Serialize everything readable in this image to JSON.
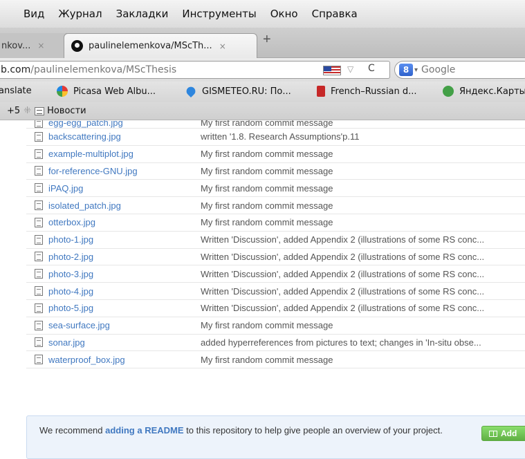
{
  "menu": [
    "Вид",
    "Журнал",
    "Закладки",
    "Инструменты",
    "Окно",
    "Справка"
  ],
  "tabs": {
    "inactive_label": "nkov...",
    "active_label": "paulinelemenkova/MScTh...",
    "close_glyph": "×",
    "new_tab_glyph": "+"
  },
  "address": {
    "host": "b.com",
    "path": "/paulinelemenkova/MScThesis",
    "dropdown_glyph": "▽",
    "reload_glyph": "C"
  },
  "search": {
    "engine_letter": "8",
    "caret_glyph": "▾",
    "placeholder": "Google"
  },
  "bookmarks": [
    {
      "label": "anslate",
      "icon": ""
    },
    {
      "label": "Picasa Web Albu...",
      "icon": "picasa-icon"
    },
    {
      "label": "GISMETEO.RU: По...",
      "icon": "gismeteo-icon"
    },
    {
      "label": "French–Russian d...",
      "icon": "book-icon"
    },
    {
      "label": "Яндекс.Карты",
      "icon": "yandex-maps-icon"
    }
  ],
  "bookmarks2": {
    "more": "+5",
    "separator": "⁜",
    "news": "Новости"
  },
  "files": [
    {
      "name": "egg-egg_patch.jpg",
      "message": "My first random commit message"
    },
    {
      "name": "backscattering.jpg",
      "message": "written '1.8. Research Assumptions'p.11"
    },
    {
      "name": "example-multiplot.jpg",
      "message": "My first random commit message"
    },
    {
      "name": "for-reference-GNU.jpg",
      "message": "My first random commit message"
    },
    {
      "name": "iPAQ.jpg",
      "message": "My first random commit message"
    },
    {
      "name": "isolated_patch.jpg",
      "message": "My first random commit message"
    },
    {
      "name": "otterbox.jpg",
      "message": "My first random commit message"
    },
    {
      "name": "photo-1.jpg",
      "message": "Written 'Discussion', added Appendix 2 (illustrations of some RS conc..."
    },
    {
      "name": "photo-2.jpg",
      "message": "Written 'Discussion', added Appendix 2 (illustrations of some RS conc..."
    },
    {
      "name": "photo-3.jpg",
      "message": "Written 'Discussion', added Appendix 2 (illustrations of some RS conc..."
    },
    {
      "name": "photo-4.jpg",
      "message": "Written 'Discussion', added Appendix 2 (illustrations of some RS conc..."
    },
    {
      "name": "photo-5.jpg",
      "message": "Written 'Discussion', added Appendix 2 (illustrations of some RS conc..."
    },
    {
      "name": "sea-surface.jpg",
      "message": "My first random commit message"
    },
    {
      "name": "sonar.jpg",
      "message": "added hyperreferences from pictures to text; changes in 'In-situ obse..."
    },
    {
      "name": "waterproof_box.jpg",
      "message": "My first random commit message"
    }
  ],
  "readme": {
    "prefix": "We recommend ",
    "link": "adding a README",
    "suffix": " to this repository to help give people an overview of your project.",
    "button": "Add"
  },
  "colors": {
    "link": "#4078c0",
    "notice_bg": "#edf3fb",
    "button_green": "#6cc644"
  }
}
